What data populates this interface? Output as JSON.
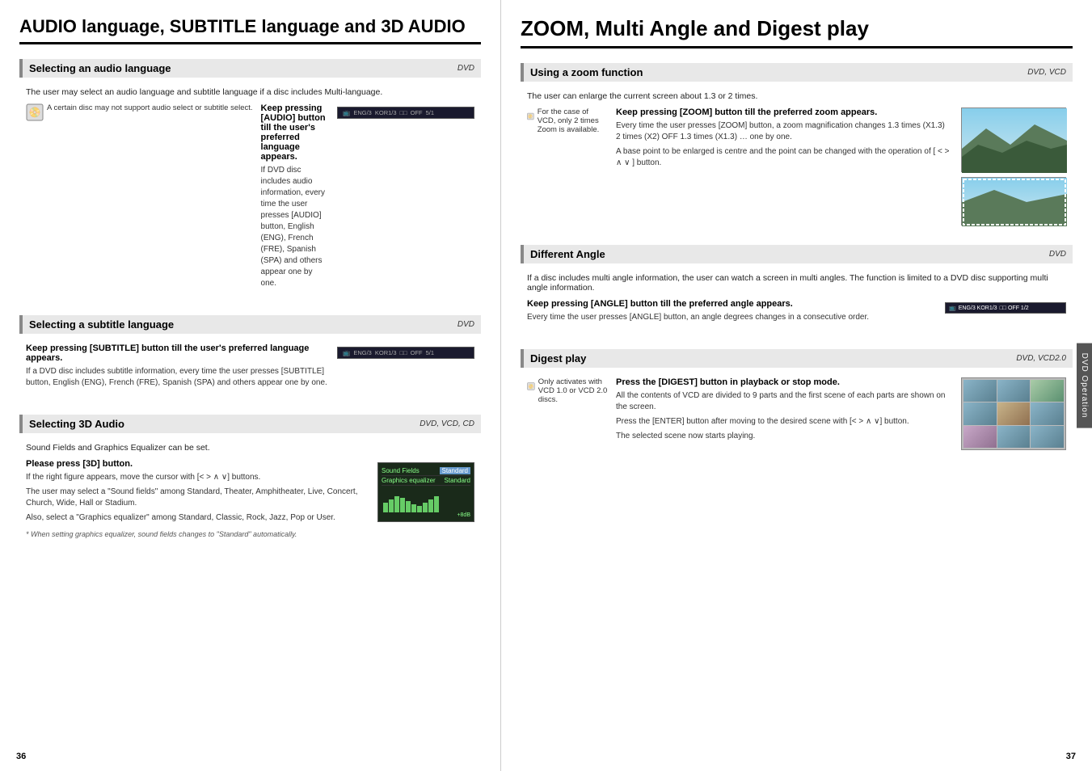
{
  "left_page": {
    "title": "AUDIO language, SUBTITLE language and 3D AUDIO",
    "page_number": "36",
    "sections": [
      {
        "id": "audio-language",
        "title": "Selecting an audio language",
        "tag": "DVD",
        "intro": "The user may select an audio language and subtitle language if a disc includes Multi-language.",
        "instruction_title": "Keep pressing [AUDIO] button till the user's preferred language appears.",
        "instruction_text": "If DVD disc includes audio information, every time the user presses [AUDIO] button, English (ENG), French (FRE), Spanish (SPA) and others appear one by one.",
        "disc_note": "A certain disc may not support audio select or subtitle select."
      },
      {
        "id": "subtitle-language",
        "title": "Selecting a subtitle language",
        "tag": "DVD",
        "instruction_title": "Keep pressing [SUBTITLE] button till the user's preferred language appears.",
        "instruction_text": "If a DVD disc includes subtitle information, every time the user presses [SUBTITLE] button, English (ENG), French (FRE), Spanish (SPA)  and others appear one by one."
      },
      {
        "id": "3d-audio",
        "title": "Selecting 3D Audio",
        "tag": "DVD, VCD, CD",
        "intro": "Sound Fields and Graphics Equalizer can be set.",
        "instruction_title": "Please press [3D] button.",
        "instruction_text_1": "If the right figure appears, move the cursor with [< > ∧ ∨] buttons.",
        "instruction_text_2": "The user may select a \"Sound fields\" among Standard, Theater, Amphitheater, Live, Concert, Church, Wide, Hall or Stadium.",
        "instruction_text_3": "Also, select a \"Graphics equalizer\" among Standard, Classic, Rock, Jazz, Pop or User.",
        "footnote": "* When setting graphics equalizer, sound fields changes to \"Standard\" automatically.",
        "eq_rows": [
          {
            "label": "Sound Fields",
            "value": "Standard"
          },
          {
            "label": "Graphics equalizer",
            "value": "Standard"
          }
        ],
        "eq_bottom_label": "+8dB"
      }
    ]
  },
  "right_page": {
    "title": "ZOOM, Multi Angle and Digest play",
    "page_number": "37",
    "dvd_operation_label": "DVD Operation",
    "sections": [
      {
        "id": "zoom",
        "title": "Using a zoom function",
        "tag": "DVD, VCD",
        "intro": "The user can enlarge the current screen about 1.3 or 2 times.",
        "instruction_title": "Keep pressing [ZOOM] button till the preferred zoom appears.",
        "instruction_text": "Every time the user presses [ZOOM] button, a zoom magnification changes 1.3 times (X1.3)    2 times (X2)  OFF    1.3 times (X1.3)    … one by one.",
        "instruction_text2": "A base point to be enlarged is centre and the point can be changed with the operation of [ < >  ∧  ∨ ] button.",
        "disc_note": "For the case of VCD, only 2 times Zoom is available."
      },
      {
        "id": "different-angle",
        "title": "Different Angle",
        "tag": "DVD",
        "intro": "If a disc includes multi angle information, the user can watch a screen in multi angles. The function is limited to a DVD disc supporting multi angle information.",
        "instruction_title": "Keep pressing [ANGLE] button till the preferred angle appears.",
        "instruction_text": "Every time the user presses [ANGLE] button, an angle degrees changes in a consecutive order."
      },
      {
        "id": "digest-play",
        "title": "Digest play",
        "tag": "DVD, VCD2.0",
        "instruction_title": "Press the [DIGEST] button in playback or stop mode.",
        "instruction_text_1": "All the contents of VCD are divided to 9 parts and the first scene of each parts are shown on the screen.",
        "instruction_text_2": "Press the [ENTER] button after moving to the desired scene with [< > ∧ ∨] button.",
        "instruction_text_3": "The selected scene now starts playing.",
        "disc_note": "Only activates with VCD 1.0 or VCD 2.0 discs."
      }
    ]
  }
}
